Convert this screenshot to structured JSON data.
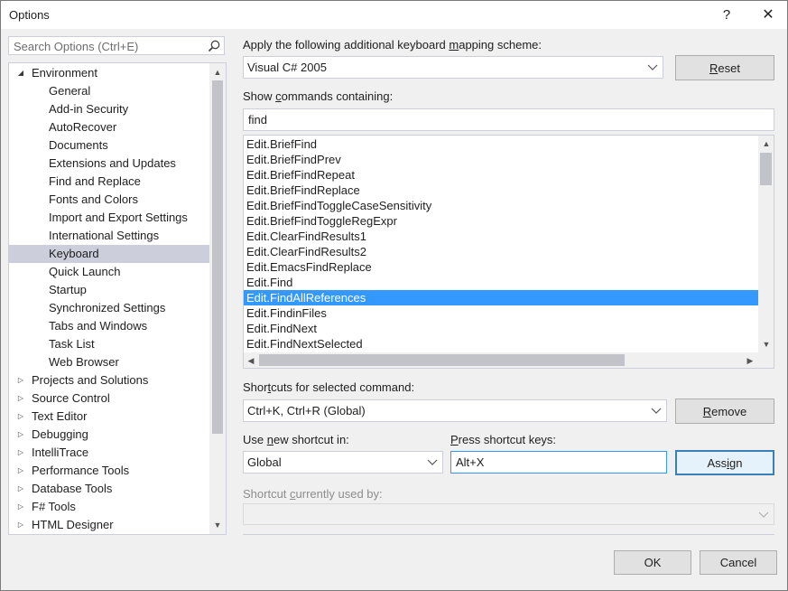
{
  "window": {
    "title": "Options",
    "help": "?",
    "close": "✕"
  },
  "search": {
    "placeholder": "Search Options (Ctrl+E)"
  },
  "tree": {
    "items": [
      {
        "label": "Environment",
        "level": 0,
        "state": "expanded"
      },
      {
        "label": "General",
        "level": 1
      },
      {
        "label": "Add-in Security",
        "level": 1
      },
      {
        "label": "AutoRecover",
        "level": 1
      },
      {
        "label": "Documents",
        "level": 1
      },
      {
        "label": "Extensions and Updates",
        "level": 1
      },
      {
        "label": "Find and Replace",
        "level": 1
      },
      {
        "label": "Fonts and Colors",
        "level": 1
      },
      {
        "label": "Import and Export Settings",
        "level": 1
      },
      {
        "label": "International Settings",
        "level": 1
      },
      {
        "label": "Keyboard",
        "level": 1,
        "selected": true
      },
      {
        "label": "Quick Launch",
        "level": 1
      },
      {
        "label": "Startup",
        "level": 1
      },
      {
        "label": "Synchronized Settings",
        "level": 1
      },
      {
        "label": "Tabs and Windows",
        "level": 1
      },
      {
        "label": "Task List",
        "level": 1
      },
      {
        "label": "Web Browser",
        "level": 1
      },
      {
        "label": "Projects and Solutions",
        "level": 0,
        "state": "collapsed"
      },
      {
        "label": "Source Control",
        "level": 0,
        "state": "collapsed"
      },
      {
        "label": "Text Editor",
        "level": 0,
        "state": "collapsed"
      },
      {
        "label": "Debugging",
        "level": 0,
        "state": "collapsed"
      },
      {
        "label": "IntelliTrace",
        "level": 0,
        "state": "collapsed"
      },
      {
        "label": "Performance Tools",
        "level": 0,
        "state": "collapsed"
      },
      {
        "label": "Database Tools",
        "level": 0,
        "state": "collapsed"
      },
      {
        "label": "F# Tools",
        "level": 0,
        "state": "collapsed"
      },
      {
        "label": "HTML Designer",
        "level": 0,
        "state": "collapsed"
      }
    ]
  },
  "mapping": {
    "label_pre": "Apply the following additional keyboard ",
    "label_ul": "m",
    "label_post": "apping scheme:",
    "value": "Visual C# 2005",
    "reset_ul": "R",
    "reset_rest": "eset"
  },
  "commands": {
    "label_pre": "Show ",
    "label_ul": "c",
    "label_post": "ommands containing:",
    "filter": "find",
    "items": [
      "Edit.BriefFind",
      "Edit.BriefFindPrev",
      "Edit.BriefFindRepeat",
      "Edit.BriefFindReplace",
      "Edit.BriefFindToggleCaseSensitivity",
      "Edit.BriefFindToggleRegExpr",
      "Edit.ClearFindResults1",
      "Edit.ClearFindResults2",
      "Edit.EmacsFindReplace",
      "Edit.Find",
      "Edit.FindAllReferences",
      "Edit.FindinFiles",
      "Edit.FindNext",
      "Edit.FindNextSelected"
    ],
    "selected_index": 10
  },
  "shortcuts": {
    "label_pre": "Shor",
    "label_ul": "t",
    "label_post": "cuts for selected command:",
    "value": "Ctrl+K, Ctrl+R (Global)",
    "remove_ul": "R",
    "remove_rest": "emove"
  },
  "new_shortcut": {
    "label_pre": "Use ",
    "label_ul": "n",
    "label_post": "ew shortcut in:",
    "scope": "Global",
    "press_pre": "",
    "press_ul": "P",
    "press_post": "ress shortcut keys:",
    "keys": "Alt+X",
    "assign_pre": "Ass",
    "assign_ul": "i",
    "assign_post": "gn"
  },
  "used_by": {
    "label_pre": "Shortcut ",
    "label_ul": "c",
    "label_post": "urrently used by:",
    "value": ""
  },
  "footer": {
    "ok": "OK",
    "cancel": "Cancel"
  },
  "colors": {
    "selection": "#3399ff",
    "tree_selection": "#cccedb",
    "default_button_border": "#3c7fb1"
  }
}
